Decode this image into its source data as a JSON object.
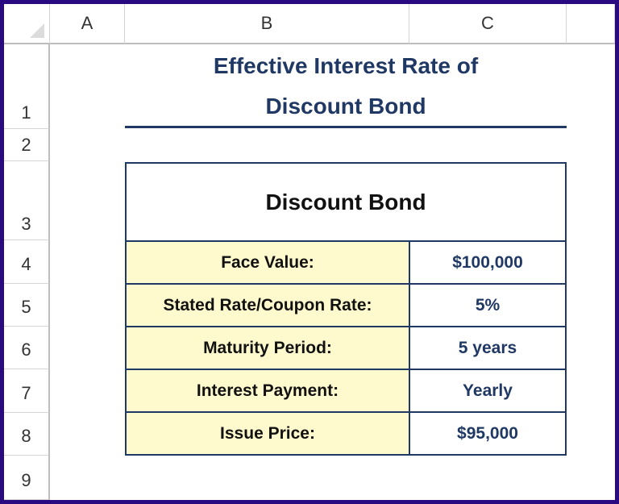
{
  "columns": [
    "A",
    "B",
    "C"
  ],
  "rows": [
    "1",
    "2",
    "3",
    "4",
    "5",
    "6",
    "7",
    "8",
    "9"
  ],
  "title": {
    "line1": "Effective Interest Rate of",
    "line2": "Discount Bond"
  },
  "table": {
    "header": "Discount Bond",
    "rows": [
      {
        "label": "Face Value:",
        "value": "$100,000"
      },
      {
        "label": "Stated Rate/Coupon Rate:",
        "value": "5%"
      },
      {
        "label": "Maturity Period:",
        "value": "5 years"
      },
      {
        "label": "Interest Payment:",
        "value": "Yearly"
      },
      {
        "label": "Issue Price:",
        "value": "$95,000"
      }
    ]
  },
  "colors": {
    "frame": "#2a0a80",
    "title": "#1f3864",
    "label_fill": "#fffacd"
  }
}
